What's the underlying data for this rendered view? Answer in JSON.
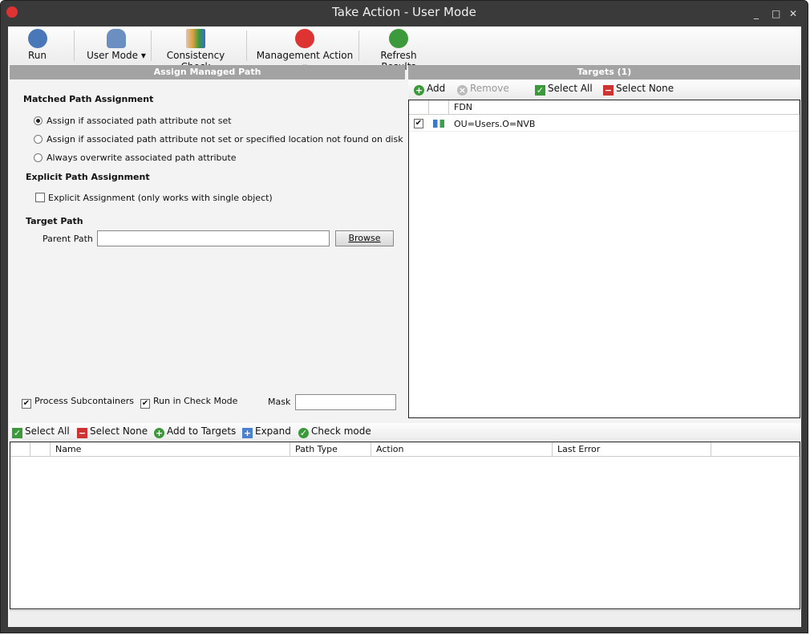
{
  "window": {
    "title": "Take Action - User Mode",
    "controls": [
      "_",
      "□",
      "✕"
    ]
  },
  "toolbar": {
    "run": "Run",
    "user_mode": "User Mode",
    "consistency_check": "Consistency Check",
    "management_action": "Management Action",
    "refresh_results": "Refresh Results"
  },
  "left": {
    "header": "Assign Managed Path",
    "matched_title": "Matched Path Assignment",
    "radios": [
      "Assign if associated path attribute not set",
      "Assign if associated path attribute not set or specified location not found on disk",
      "Always overwrite associated path attribute"
    ],
    "explicit_title": "Explicit Path Assignment",
    "explicit_cb": "Explicit Assignment (only works with single object)",
    "target_title": "Target Path",
    "parent_path_label": "Parent Path",
    "parent_path_value": "",
    "browse": "Browse",
    "process_sub": "Process Subcontainers",
    "run_check": "Run in Check Mode",
    "mask_label": "Mask",
    "mask_value": ""
  },
  "right": {
    "header": "Targets  (1)",
    "add": "Add",
    "remove": "Remove",
    "select_all": "Select All",
    "select_none": "Select None",
    "col_fdn": "FDN",
    "rows": [
      {
        "checked": true,
        "fdn": "OU=Users.O=NVB"
      }
    ]
  },
  "bottom": {
    "select_all": "Select All",
    "select_none": "Select None",
    "add_to_targets": "Add to Targets",
    "expand": "Expand",
    "check_mode": "Check mode",
    "cols": [
      "Name",
      "Path Type",
      "Action",
      "Last Error"
    ]
  }
}
